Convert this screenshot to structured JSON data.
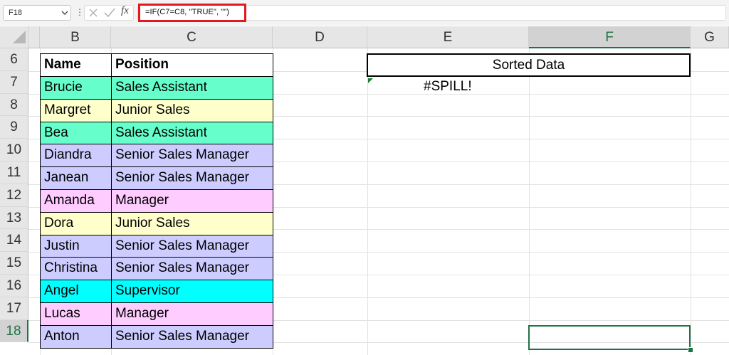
{
  "formula_bar": {
    "name_box": "F18",
    "formula": "=IF(C7=C8, \"TRUE\", \"\")",
    "cancel_icon": "x-icon",
    "enter_icon": "check-icon",
    "fx_label": "fx"
  },
  "columns": [
    {
      "label": "B",
      "selected": false
    },
    {
      "label": "C",
      "selected": false
    },
    {
      "label": "D",
      "selected": false
    },
    {
      "label": "E",
      "selected": false
    },
    {
      "label": "F",
      "selected": true
    },
    {
      "label": "G",
      "selected": false
    }
  ],
  "rows": [
    "6",
    "7",
    "8",
    "9",
    "10",
    "11",
    "12",
    "13",
    "14",
    "15",
    "16",
    "17",
    "18"
  ],
  "selected_row": "18",
  "table": {
    "headers": [
      "Name",
      "Position"
    ],
    "rows": [
      {
        "name": "Brucie",
        "position": "Sales Assistant",
        "color": "#66ffcc"
      },
      {
        "name": "Margret",
        "position": "Junior Sales",
        "color": "#ffffcc"
      },
      {
        "name": "Bea",
        "position": "Sales Assistant",
        "color": "#66ffcc"
      },
      {
        "name": "Diandra",
        "position": "Senior Sales Manager",
        "color": "#ccccff"
      },
      {
        "name": "Janean",
        "position": "Senior Sales Manager",
        "color": "#ccccff"
      },
      {
        "name": "Amanda",
        "position": "Manager",
        "color": "#ffccff"
      },
      {
        "name": "Dora",
        "position": "Junior Sales",
        "color": "#ffffcc"
      },
      {
        "name": "Justin",
        "position": "Senior Sales Manager",
        "color": "#ccccff"
      },
      {
        "name": "Christina",
        "position": "Senior Sales Manager",
        "color": "#ccccff"
      },
      {
        "name": "Angel",
        "position": "Supervisor",
        "color": "#00ffff"
      },
      {
        "name": "Lucas",
        "position": "Manager",
        "color": "#ffccff"
      },
      {
        "name": "Anton",
        "position": "Senior Sales Manager",
        "color": "#ccccff"
      }
    ]
  },
  "sorted_header": "Sorted Data",
  "spill_error": "#SPILL!",
  "colors": {
    "accent": "#217346",
    "highlight": "#e01a22"
  }
}
